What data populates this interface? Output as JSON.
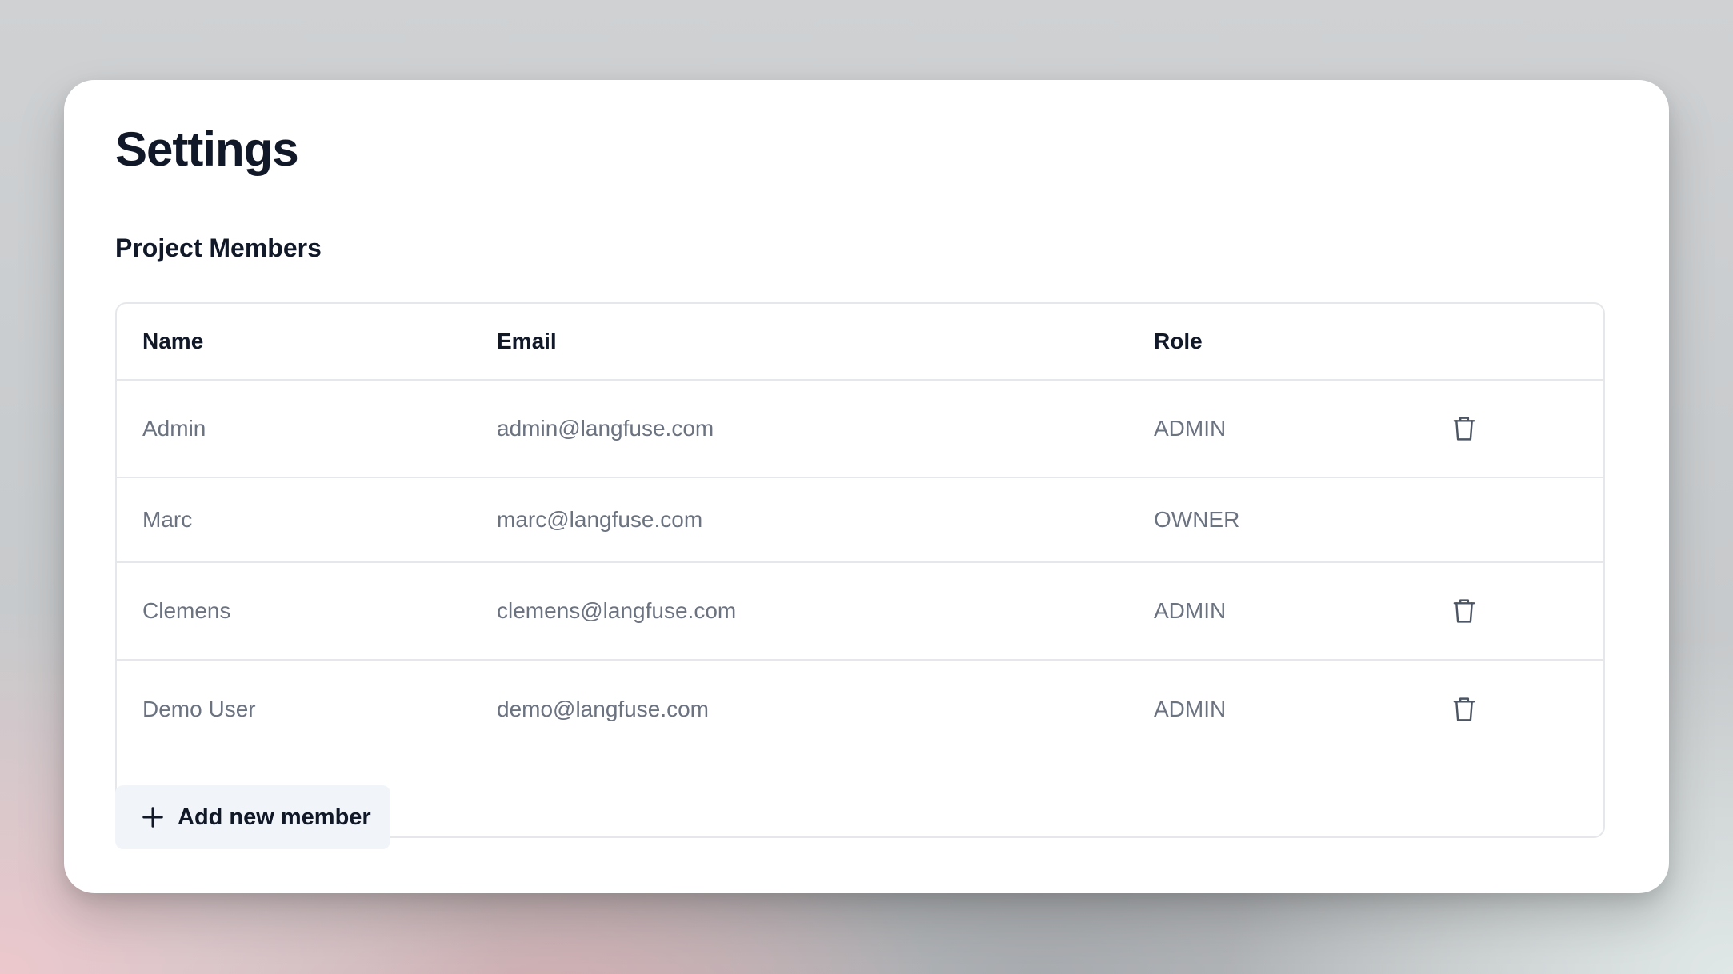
{
  "page": {
    "title": "Settings"
  },
  "members_section": {
    "title": "Project Members",
    "columns": [
      "Name",
      "Email",
      "Role",
      ""
    ],
    "rows": [
      {
        "name": "Admin",
        "email": "admin@langfuse.com",
        "role": "ADMIN",
        "action_icon": "trash-icon"
      },
      {
        "name": "Marc",
        "email": "marc@langfuse.com",
        "role": "OWNER",
        "action_icon": ""
      },
      {
        "name": "Clemens",
        "email": "clemens@langfuse.com",
        "role": "ADMIN",
        "action_icon": "trash-icon"
      },
      {
        "name": "Demo User",
        "email": "demo@langfuse.com",
        "role": "ADMIN",
        "action_icon": "trash-icon"
      }
    ],
    "add_button": {
      "label": "Add new member",
      "icon": "plus-icon"
    }
  },
  "colors": {
    "heading": "#111827",
    "muted_text": "#6b7280",
    "border": "#e5e7eb",
    "button_bg": "#f1f5f9"
  }
}
